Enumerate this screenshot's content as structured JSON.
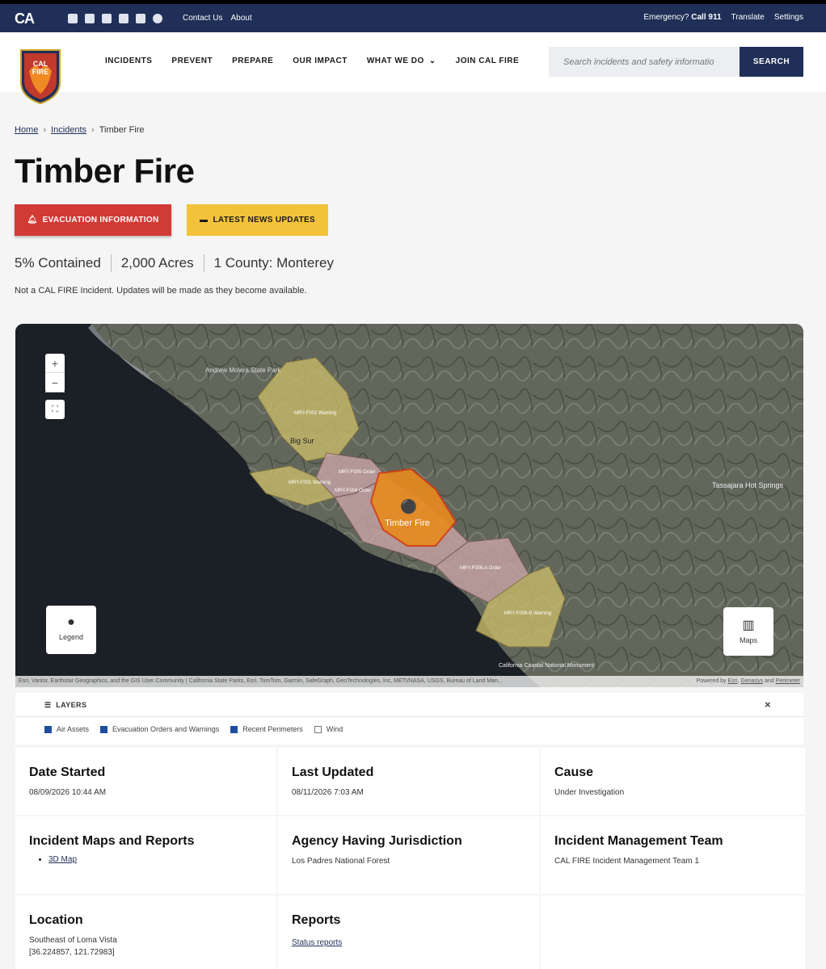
{
  "topbar": {
    "logo": "CA",
    "links": [
      "Contact Us",
      "About"
    ],
    "emergency_prefix": "Emergency?",
    "emergency_call": "Call 911",
    "translate": "Translate",
    "settings": "Settings"
  },
  "header": {
    "badge_lines": [
      "CAL",
      "FIRE"
    ],
    "nav": [
      "INCIDENTS",
      "PREVENT",
      "PREPARE",
      "OUR IMPACT",
      "WHAT WE DO",
      "JOIN CAL FIRE"
    ],
    "search_placeholder": "Search incidents and safety informatio",
    "search_button": "SEARCH"
  },
  "breadcrumb": {
    "home": "Home",
    "incidents": "Incidents",
    "current": "Timber Fire"
  },
  "incident": {
    "title": "Timber Fire",
    "evac_button": "EVACUATION INFORMATION",
    "news_button": "LATEST NEWS UPDATES",
    "contained": "5% Contained",
    "acres": "2,000 Acres",
    "county": "1 County: Monterey",
    "notice": "Not a CAL FIRE Incident. Updates will be made as they become available."
  },
  "map": {
    "labels": {
      "park": "Andrew Molera State Park",
      "town": "Big Sur",
      "springs": "Tassajara Hot Springs",
      "monument": "California Coastal National Monument",
      "zone1": "MRY-F002 Warning",
      "zone2": "MRY-F001 Warning",
      "zone3": "MRY-F005 Order",
      "zone4": "MRY-F004 Order",
      "zone5": "MRY-F006-A Order",
      "zone6": "MRY-F008-B Warning",
      "fire": "Timber Fire"
    },
    "legend_label": "Legend",
    "maps_label": "Maps",
    "attribution": "Esri, Vantor, Earthstar Geographics, and the GIS User Community | California State Parks, Esri, TomTom, Garmin, SafeGraph, GeoTechnologies, Inc, METI/NASA, USGS, Bureau of Land Man...",
    "powered_by": "Powered by",
    "powered_links": [
      "Esri",
      "Genasys",
      "Perimeter"
    ]
  },
  "layers": {
    "title": "LAYERS",
    "options": [
      {
        "label": "Air Assets",
        "checked": true
      },
      {
        "label": "Evacuation Orders and Warnings",
        "checked": true
      },
      {
        "label": "Recent Perimeters",
        "checked": true
      },
      {
        "label": "Wind",
        "checked": false
      }
    ]
  },
  "details": {
    "date_started": {
      "label": "Date Started",
      "value": "08/09/2026 10:44 AM"
    },
    "last_updated": {
      "label": "Last Updated",
      "value": "08/11/2026 7:03 AM"
    },
    "cause": {
      "label": "Cause",
      "value": "Under Investigation"
    },
    "maps_reports": {
      "label": "Incident Maps and Reports",
      "link": "3D Map"
    },
    "jurisdiction": {
      "label": "Agency Having Jurisdiction",
      "value": "Los Padres National Forest"
    },
    "team": {
      "label": "Incident Management Team",
      "value": "CAL FIRE Incident Management Team 1"
    },
    "location": {
      "label": "Location",
      "value": "Southeast of Loma Vista",
      "coords": "[36.224857, 121.72983]"
    },
    "reports": {
      "label": "Reports",
      "link": "Status reports"
    }
  },
  "colors": {
    "navy": "#1f2f57",
    "evac_red": "#d23a35",
    "news_yellow": "#f2c23a"
  }
}
